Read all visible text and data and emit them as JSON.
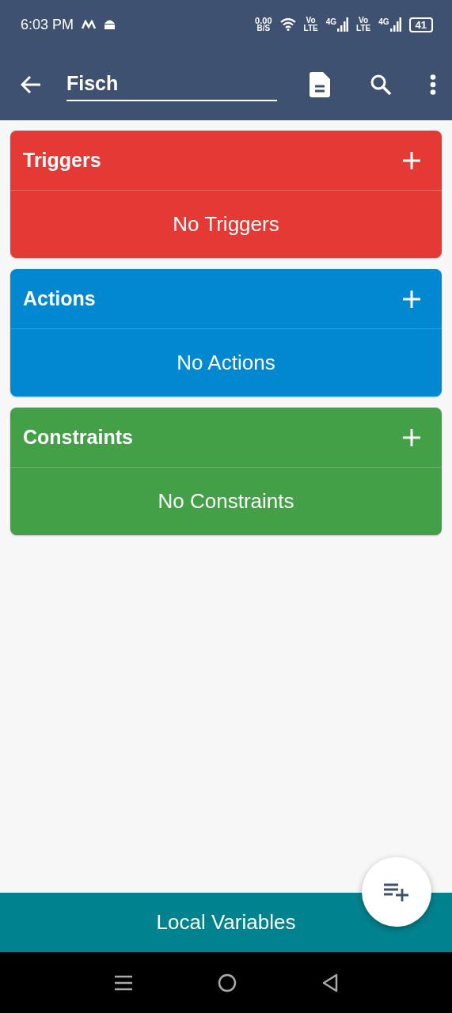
{
  "status_bar": {
    "time": "6:03 PM",
    "speed": "0.00",
    "speed_unit": "B/S",
    "sims": [
      {
        "volte_top": "Vo",
        "volte_bottom": "LTE",
        "network": "4G"
      },
      {
        "volte_top": "Vo",
        "volte_bottom": "LTE",
        "network": "4G"
      }
    ],
    "battery": "41"
  },
  "app_bar": {
    "title_value": "Fisch"
  },
  "sections": [
    {
      "title": "Triggers",
      "empty_text": "No Triggers",
      "color": "#e53935"
    },
    {
      "title": "Actions",
      "empty_text": "No Actions",
      "color": "#0288d1"
    },
    {
      "title": "Constraints",
      "empty_text": "No Constraints",
      "color": "#43a047"
    }
  ],
  "bottom_bar": {
    "label": "Local Variables"
  }
}
